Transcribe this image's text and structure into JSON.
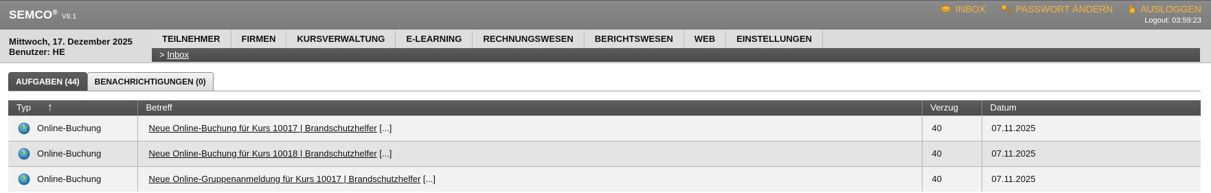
{
  "header": {
    "brand": "SEMCO",
    "brand_mark": "®",
    "version": "V8.1",
    "links": {
      "inbox": "INBOX",
      "password": "PASSWORT ÄNDERN",
      "logout": "AUSLOGGEN"
    },
    "logout_timer": "Logout: 03:59:23",
    "accent_color": "#f5b637"
  },
  "userinfo": {
    "date": "Mittwoch, 17. Dezember 2025",
    "user": "Benutzer: HE"
  },
  "nav": {
    "items": [
      "TEILNEHMER",
      "FIRMEN",
      "KURSVERWALTUNG",
      "E-LEARNING",
      "RECHNUNGSWESEN",
      "BERICHTSWESEN",
      "WEB",
      "EINSTELLUNGEN"
    ]
  },
  "breadcrumb": {
    "prefix": ">",
    "current": "Inbox"
  },
  "tabs": [
    {
      "label": "AUFGABEN (44)",
      "active": true
    },
    {
      "label": "BENACHRICHTIGUNGEN (0)",
      "active": false
    }
  ],
  "table": {
    "columns": {
      "typ": "Typ",
      "sort_indicator": "↑",
      "betreff": "Betreff",
      "verzug": "Verzug",
      "datum": "Datum"
    },
    "type_icon": "globe-icon",
    "rows": [
      {
        "typ": "Online-Buchung",
        "betreff": "Neue Online-Buchung für Kurs 10017 | Brandschutzhelfer",
        "more": "[...]",
        "verzug": "40",
        "datum": "07.11.2025"
      },
      {
        "typ": "Online-Buchung",
        "betreff": "Neue Online-Buchung für Kurs 10018 | Brandschutzhelfer",
        "more": "[...]",
        "verzug": "40",
        "datum": "07.11.2025"
      },
      {
        "typ": "Online-Buchung",
        "betreff": "Neue Online-Gruppenanmeldung für Kurs 10017 | Brandschutzhelfer",
        "more": "[...]",
        "verzug": "40",
        "datum": "07.11.2025"
      }
    ]
  }
}
